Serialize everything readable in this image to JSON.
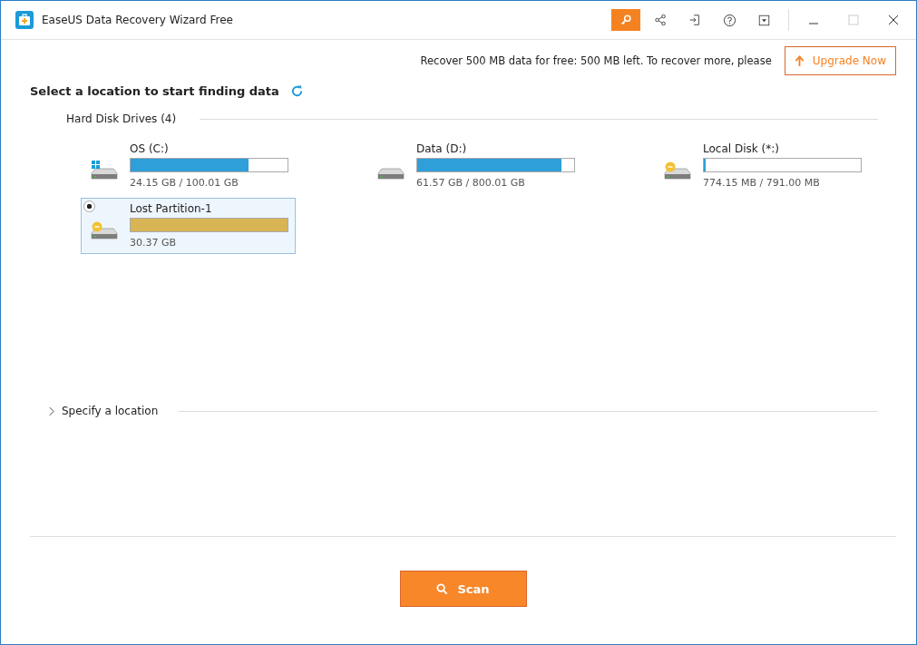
{
  "window": {
    "title": "EaseUS Data Recovery Wizard Free"
  },
  "toolbar": [
    {
      "kind": "key",
      "selected": true
    },
    {
      "kind": "share",
      "selected": false
    },
    {
      "kind": "exit",
      "selected": false
    },
    {
      "kind": "help",
      "selected": false
    },
    {
      "kind": "menu",
      "selected": false
    }
  ],
  "window_controls": [
    {
      "kind": "minimize",
      "disabled": false
    },
    {
      "kind": "maximize",
      "disabled": true
    },
    {
      "kind": "close",
      "disabled": false
    }
  ],
  "upgrade": {
    "message": "Recover 500 MB data for free: 500 MB left. To recover more, please",
    "button": "Upgrade Now"
  },
  "heading": "Select a location to start finding data",
  "hard_disk_drives": {
    "title": "Hard Disk Drives (4)",
    "drives": [
      {
        "kind": "system",
        "name": "OS (C:)",
        "level": 0.75,
        "size": "24.15 GB / 100.01 GB",
        "selected": false
      },
      {
        "kind": "plain",
        "name": "Data (D:)",
        "level": 0.92,
        "size": "61.57 GB / 800.01 GB",
        "selected": false
      },
      {
        "kind": "unallocated",
        "name": "Local Disk (*:)",
        "level": 0.01,
        "size": "774.15 MB / 791.00 MB",
        "selected": false
      },
      {
        "kind": "lost",
        "name": "Lost Partition-1",
        "level": 1,
        "size": "30.37 GB",
        "selected": true
      }
    ]
  },
  "specify_location": {
    "label": "Specify a location",
    "expanded": false
  },
  "scan_button": "Scan"
}
